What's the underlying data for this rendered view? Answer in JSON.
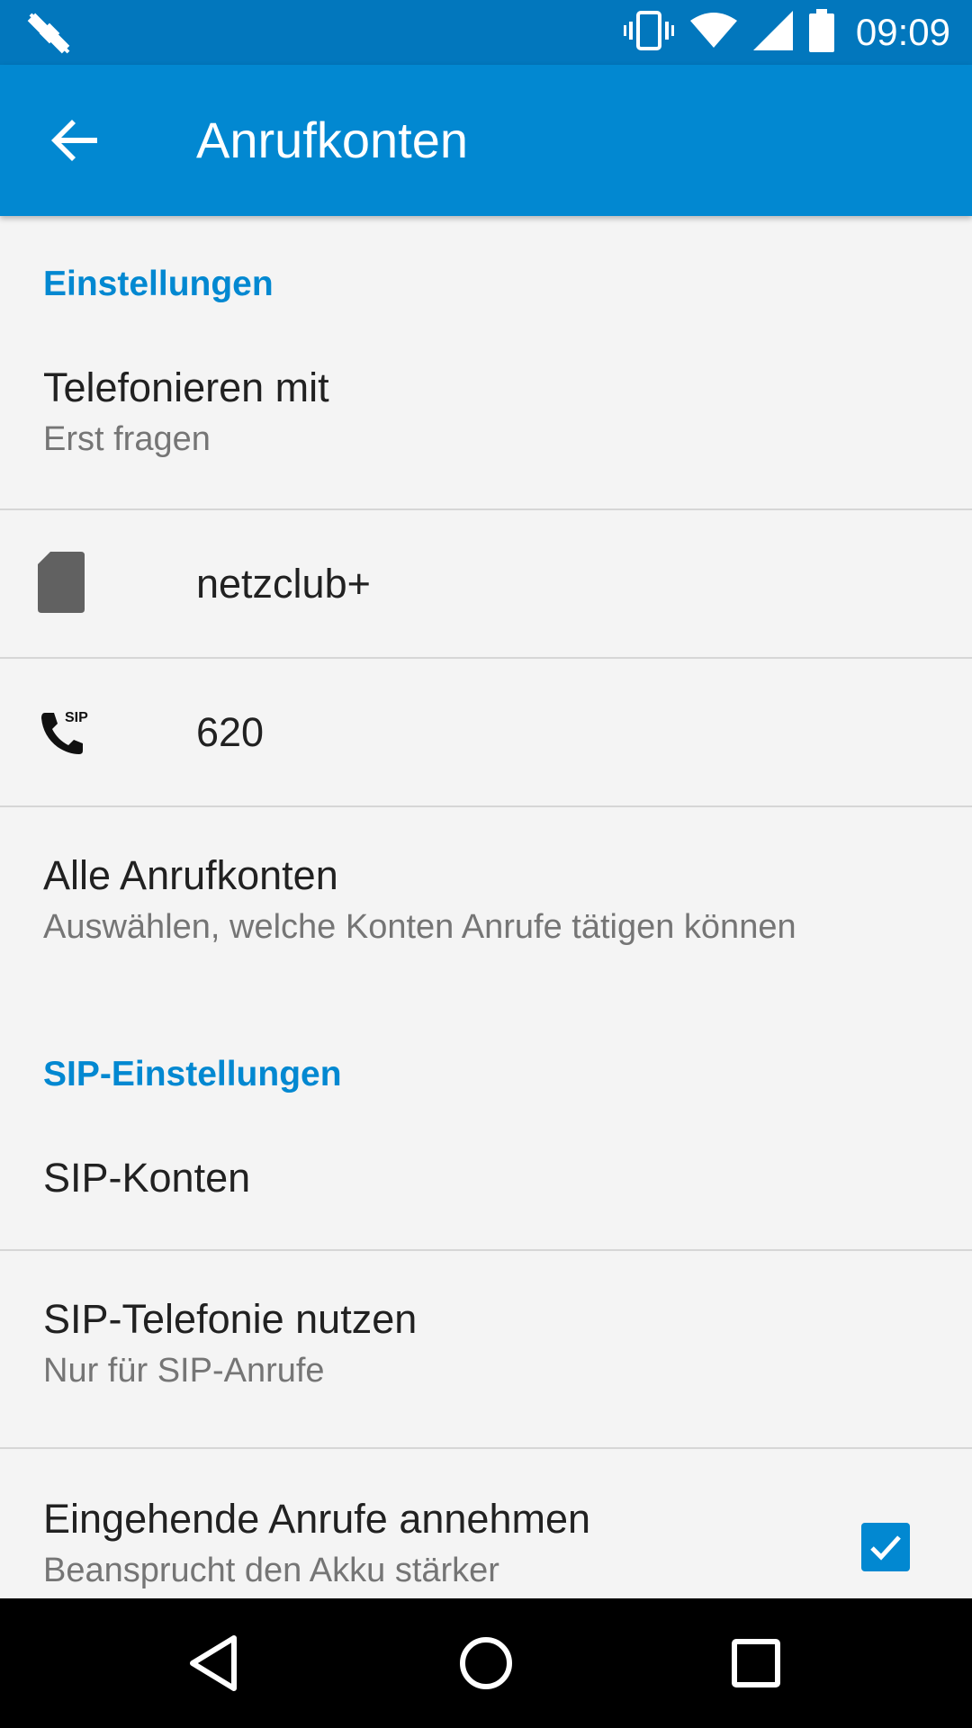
{
  "status_bar": {
    "time": "09:09",
    "icons": [
      "satellite-icon",
      "vibrate-icon",
      "wifi-icon",
      "signal-icon",
      "battery-icon"
    ]
  },
  "app_bar": {
    "title": "Anrufkonten",
    "back_icon": "arrow-back-icon"
  },
  "sections": {
    "einstellungen_header": "Einstellungen",
    "sip_header": "SIP-Einstellungen"
  },
  "prefs": {
    "telefonieren_title": "Telefonieren mit",
    "telefonieren_summary": "Erst fragen",
    "alle_title": "Alle Anrufkonten",
    "alle_summary": "Auswählen, welche Konten Anrufe tätigen können",
    "sip_konten_title": "SIP-Konten",
    "sip_nutzen_title": "SIP-Telefonie nutzen",
    "sip_nutzen_summary": "Nur für SIP-Anrufe",
    "eingehend_title": "Eingehende Anrufe annehmen",
    "eingehend_summary": "Beansprucht den Akku stärker",
    "eingehend_checked": true
  },
  "accounts": [
    {
      "label": "netzclub+",
      "icon": "sim-card-icon"
    },
    {
      "label": "620",
      "icon": "sip-phone-icon"
    }
  ],
  "colors": {
    "status_bar": "#0277bd",
    "app_bar": "#0288d1",
    "accent": "#0288d1",
    "background": "#f4f4f4"
  },
  "nav_bar": {
    "buttons": [
      "back-nav-icon",
      "home-nav-icon",
      "recents-nav-icon"
    ]
  }
}
